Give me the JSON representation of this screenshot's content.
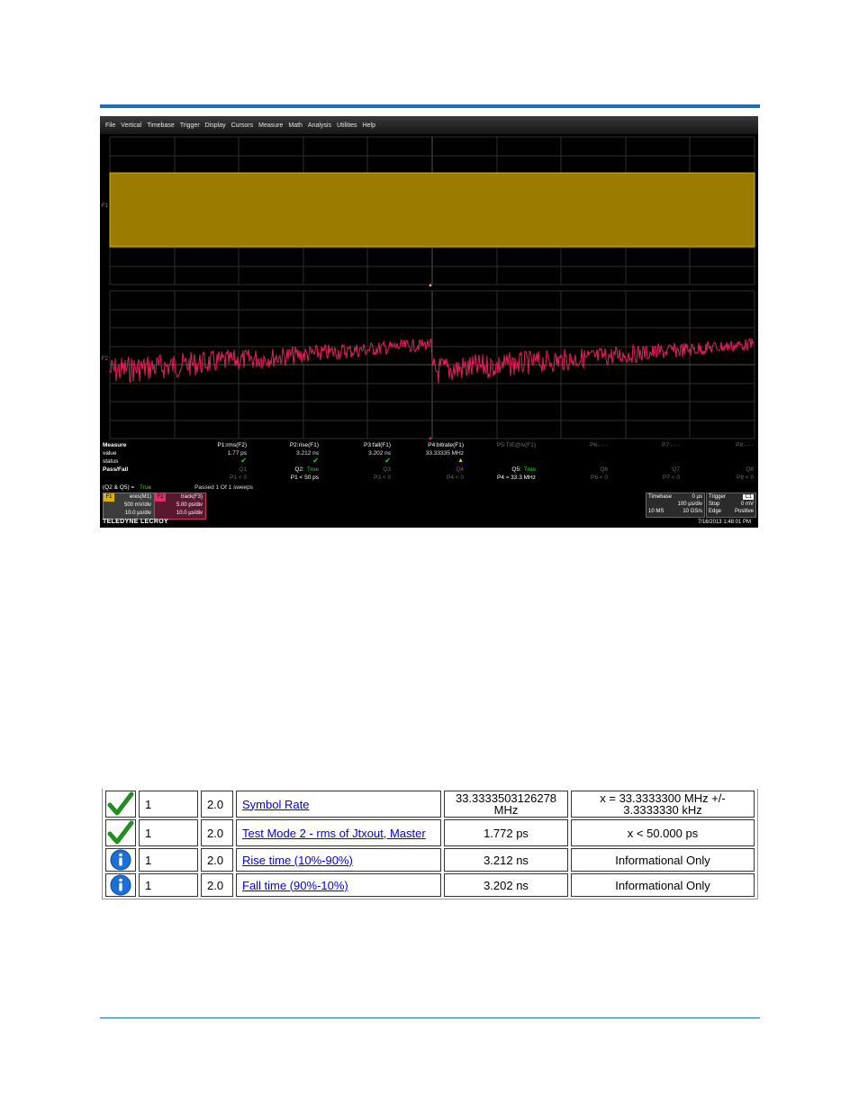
{
  "scope": {
    "menu": [
      "File",
      "Vertical",
      "Timebase",
      "Trigger",
      "Display",
      "Cursors",
      "Measure",
      "Math",
      "Analysis",
      "Utilities",
      "Help"
    ],
    "trace_labels": {
      "top": "F1",
      "bottom": "F2"
    },
    "measure": {
      "row_labels": [
        "Measure",
        "value",
        "status",
        "Pass/Fail"
      ],
      "params": [
        {
          "name": "P1:rms(F2)",
          "value": "1.77 ps",
          "status": "check",
          "q": "Q1",
          "q_result": "",
          "limit": "P1 < 0"
        },
        {
          "name": "P2:rise(F1)",
          "value": "3.212 ns",
          "status": "check",
          "q": "Q2:",
          "q_result": "True",
          "limit": "P1 < 50 ps"
        },
        {
          "name": "P3:fall(F1)",
          "value": "3.202 ns",
          "status": "check",
          "q": "Q3",
          "q_result": "",
          "limit": "P3 < 0"
        },
        {
          "name": "P4:bitrate(F1)",
          "value": "33.33335 MHz",
          "status": "warn",
          "q": "Q4",
          "q_result": "",
          "limit": "P4 < 0"
        },
        {
          "name": "P5:TIE@lv(F1)",
          "value": "",
          "status": "",
          "q": "Q5:",
          "q_result": "True",
          "limit": "P4 ≈ 33.3 MHz"
        },
        {
          "name": "P6:- - -",
          "value": "",
          "status": "",
          "q": "Q6",
          "q_result": "",
          "limit": "P6 < 0"
        },
        {
          "name": "P7:- - -",
          "value": "",
          "status": "",
          "q": "Q7",
          "q_result": "",
          "limit": "P7 < 0"
        },
        {
          "name": "P8:- - -",
          "value": "",
          "status": "",
          "q": "Q8",
          "q_result": "",
          "limit": "P8 < 0"
        }
      ],
      "q_expr": "(Q2 & Q5) =",
      "q_expr_result": "True",
      "passed": "Passed  1   Of  1   sweeps"
    },
    "channels": [
      {
        "tag": "F1",
        "name": "eres(M1)",
        "vdiv": "500 mV/div",
        "tdiv": "10.0 µs/div",
        "color": "#e0b000"
      },
      {
        "tag": "F2",
        "name": "track(F3)",
        "vdiv": "5.00 ps/div",
        "tdiv": "10.0 µs/div",
        "color": "#e0306a"
      }
    ],
    "brand": "TELEDYNE LECROY",
    "timebase": {
      "label": "Timebase",
      "delay": "0 µs",
      "tdiv": "100 µs/div",
      "samples": "10 MS",
      "rate": "10 GS/s"
    },
    "trigger": {
      "label": "Trigger",
      "channel": "C1",
      "mode": "Stop",
      "level": "0 mV",
      "type": "Edge",
      "slope": "Positive"
    },
    "datestamp": "7/16/2013 1:48:01 PM"
  },
  "results": [
    {
      "status": "pass",
      "count": "1",
      "ver": "2.0",
      "name": "Symbol Rate",
      "value": "33.3333503126278 MHz",
      "limit": "x = 33.3333300 MHz +/- 3.3333330 kHz"
    },
    {
      "status": "pass",
      "count": "1",
      "ver": "2.0",
      "name": "Test Mode 2 - rms of Jtxout, Master",
      "value": "1.772 ps",
      "limit": "x < 50.000 ps"
    },
    {
      "status": "info",
      "count": "1",
      "ver": "2.0",
      "name": "Rise time (10%-90%)",
      "value": "3.212 ns",
      "limit": "Informational Only"
    },
    {
      "status": "info",
      "count": "1",
      "ver": "2.0",
      "name": "Fall time (90%-10%)",
      "value": "3.202 ns",
      "limit": "Informational Only"
    }
  ]
}
